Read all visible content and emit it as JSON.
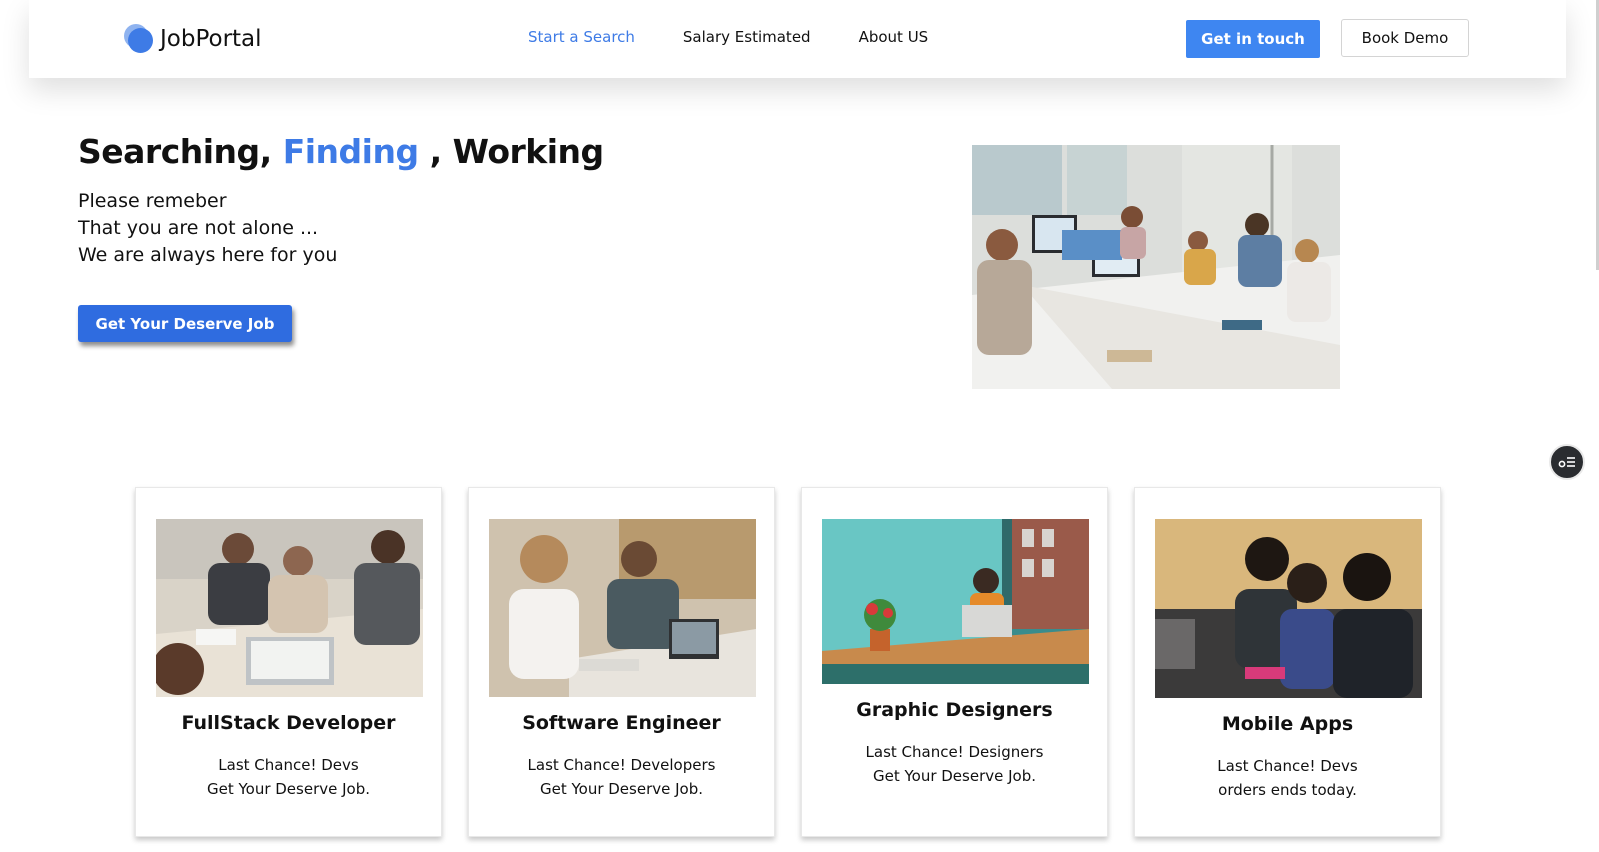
{
  "header": {
    "logo_text": "JobPortal",
    "nav": [
      {
        "label": "Start a Search",
        "active": true
      },
      {
        "label": "Salary Estimated",
        "active": false
      },
      {
        "label": "About US",
        "active": false
      }
    ],
    "primary_button": "Get in touch",
    "secondary_button": "Book Demo"
  },
  "hero": {
    "title_part1": "Searching, ",
    "title_highlight": "Finding",
    "title_part2": " , Working",
    "lines": [
      "Please remeber",
      "That you are not alone ...",
      "We are always here for you"
    ],
    "cta": "Get Your Deserve Job"
  },
  "cards": [
    {
      "title": "FullStack Developer",
      "line1": "Last Chance! Devs",
      "line2": "Get Your Deserve Job."
    },
    {
      "title": "Software Engineer",
      "line1": "Last Chance! Developers",
      "line2": "Get Your Deserve Job."
    },
    {
      "title": "Graphic Designers",
      "line1": "Last Chance! Designers",
      "line2": "Get Your Deserve Job."
    },
    {
      "title": "Mobile Apps",
      "line1": "Last Chance! Devs",
      "line2": "orders ends today."
    }
  ],
  "colors": {
    "accent": "#3e7be6",
    "primary_button": "#3e86f1",
    "cta_button": "#2f6ce0",
    "float_button": "#2a2c30"
  },
  "icons": {
    "logo": "logo-icon",
    "floating": "settings-toggle-icon"
  }
}
